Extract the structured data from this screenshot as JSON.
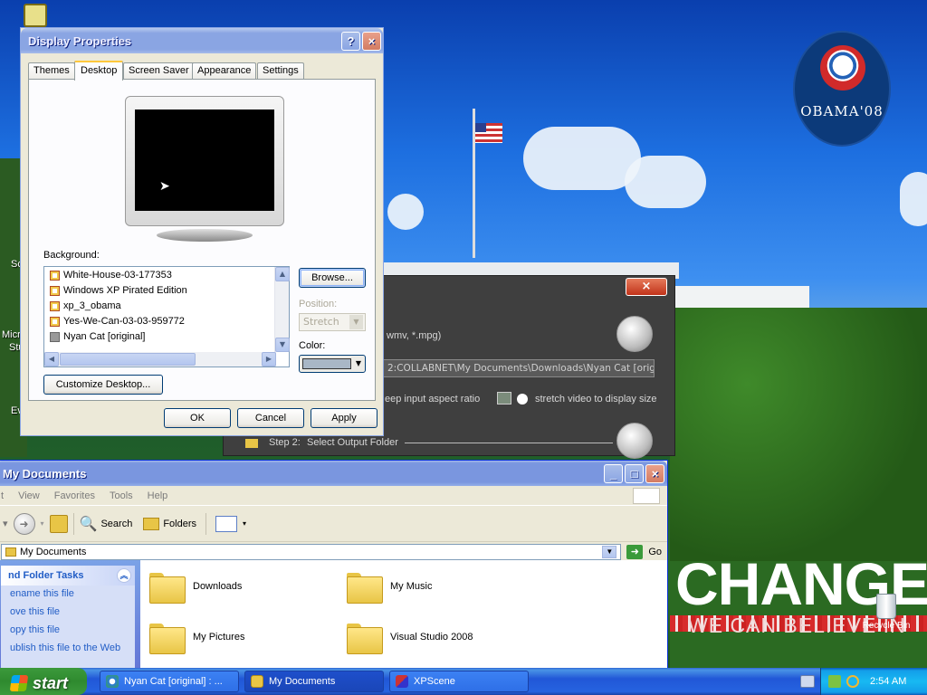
{
  "desktop": {
    "logo_text": "OBAMA'08",
    "change_text": "CHANGE",
    "change_subtext": "WE CAN BELIEVE IN",
    "recycle_bin_label": "Recycle Bin",
    "edge_labels": [
      "Micro",
      "Stu",
      "Ev",
      "Sc"
    ]
  },
  "xpscene": {
    "close_label": "×",
    "filetypes_text": "wmv, *.mpg)",
    "path_text": "2:COLLABNET\\My Documents\\Downloads\\Nyan Cat [original",
    "aspect_text": "eep input aspect ratio",
    "stretch_text": "stretch video to display size",
    "step2_text": "Step 2:",
    "step2_label": "Select Output Folder"
  },
  "display_properties": {
    "title": "Display Properties",
    "help_label": "?",
    "close_label": "×",
    "tabs": [
      {
        "label": "Themes"
      },
      {
        "label": "Desktop"
      },
      {
        "label": "Screen Saver"
      },
      {
        "label": "Appearance"
      },
      {
        "label": "Settings"
      }
    ],
    "selected_tab": "Desktop",
    "background_label": "Background:",
    "backgrounds": [
      "White-House-03-177353",
      "Windows XP Pirated Edition",
      "xp_3_obama",
      "Yes-We-Can-03-03-959772",
      "Nyan Cat [original]"
    ],
    "browse_label": "Browse...",
    "position_label": "Position:",
    "position_value": "Stretch",
    "color_label": "Color:",
    "color_value": "#a9b7c6",
    "customize_label": "Customize Desktop...",
    "ok_label": "OK",
    "cancel_label": "Cancel",
    "apply_label": "Apply"
  },
  "my_documents": {
    "title": "My Documents",
    "menu": [
      "t",
      "View",
      "Favorites",
      "Tools",
      "Help"
    ],
    "toolbar": {
      "search_label": "Search",
      "folders_label": "Folders"
    },
    "address_value": "My Documents",
    "go_label": "Go",
    "tasks_header": "nd Folder Tasks",
    "tasks": [
      "ename this file",
      "ove this file",
      "opy this file",
      "ublish this file to the Web"
    ],
    "items": [
      {
        "name": "Downloads"
      },
      {
        "name": "My Music"
      },
      {
        "name": "My Pictures"
      },
      {
        "name": "Visual Studio 2008"
      }
    ]
  },
  "taskbar": {
    "start_label": "start",
    "items": [
      {
        "label": "Nyan Cat [original] : ..."
      },
      {
        "label": "My Documents"
      },
      {
        "label": "XPScene"
      }
    ],
    "clock": "2:54 AM"
  }
}
